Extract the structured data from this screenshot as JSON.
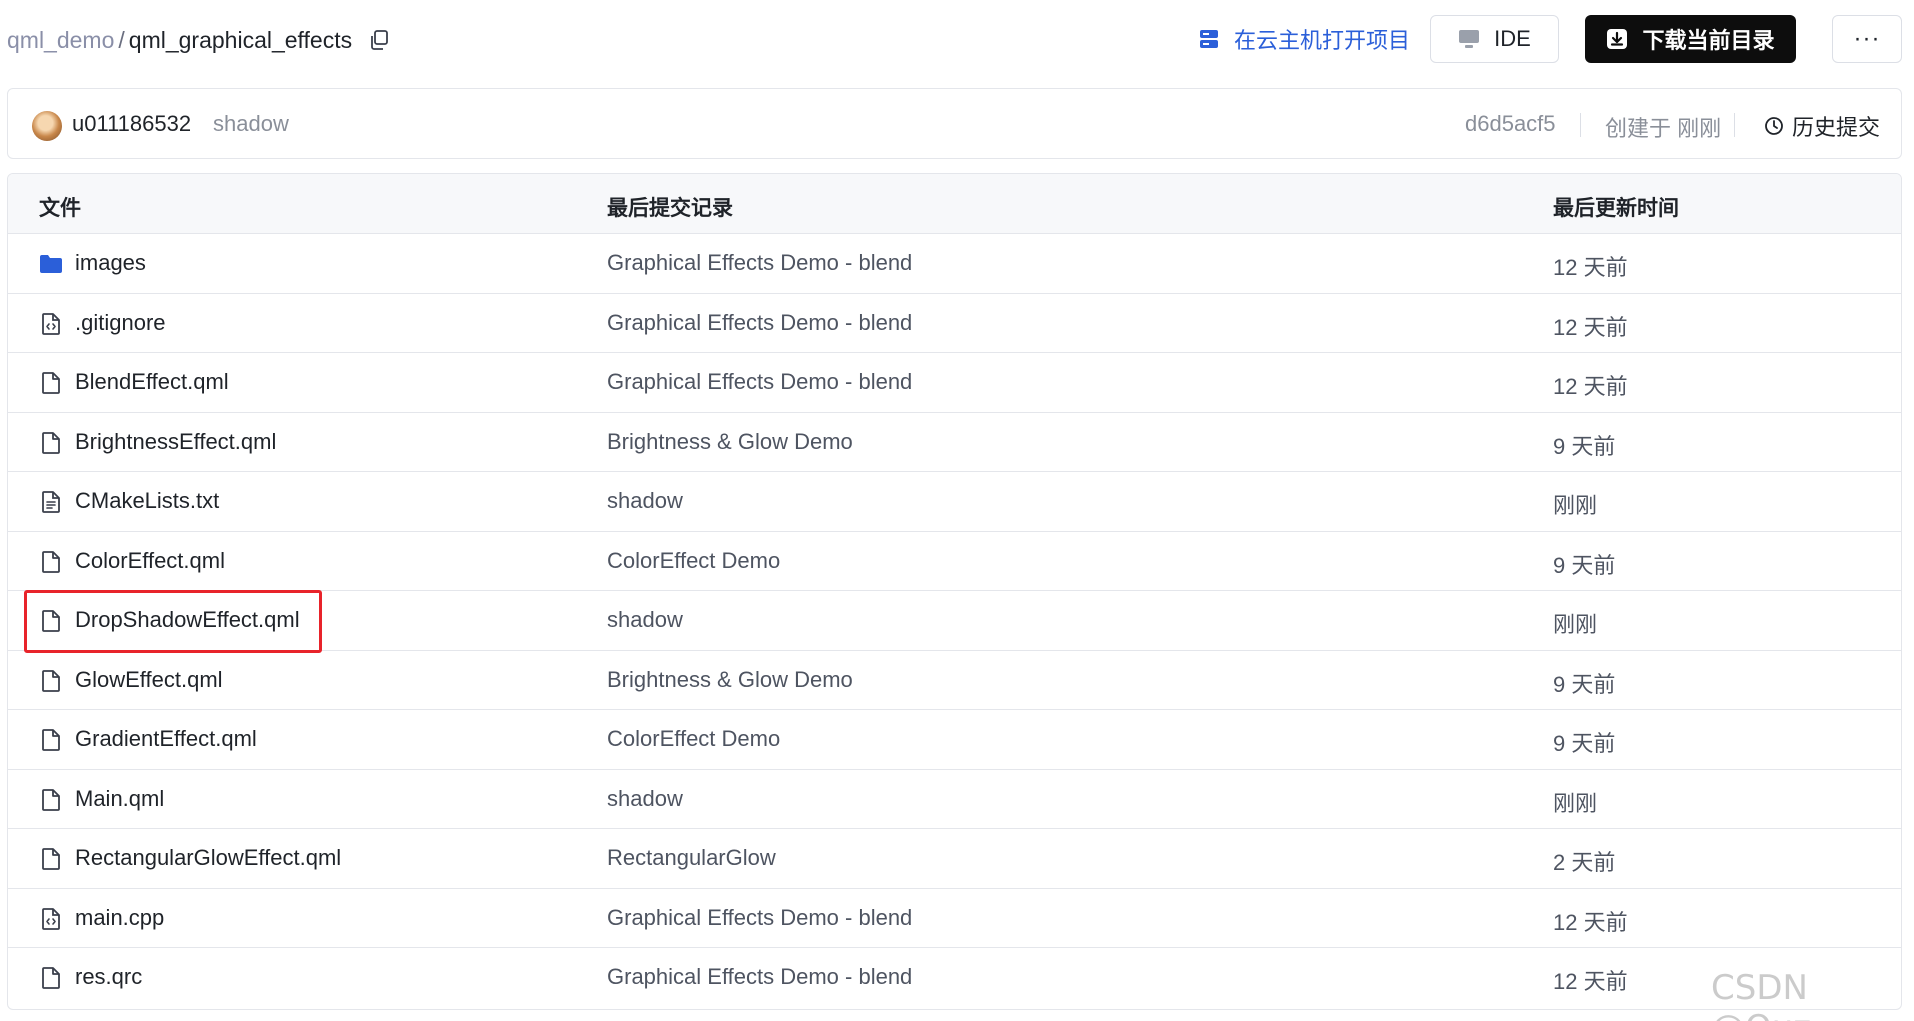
{
  "breadcrumb": {
    "parent": "qml_demo",
    "separator": "/",
    "current": "qml_graphical_effects"
  },
  "actions": {
    "cloud_label": "在云主机打开项目",
    "ide_label": "IDE",
    "download_label": "下载当前目录",
    "more_label": "···"
  },
  "commit": {
    "user": "u011186532",
    "message": "shadow",
    "hash": "d6d5acf5",
    "created": "创建于 刚刚",
    "history_label": "历史提交"
  },
  "table": {
    "headers": {
      "file": "文件",
      "commit": "最后提交记录",
      "time": "最后更新时间"
    },
    "rows": [
      {
        "icon": "folder",
        "name": "images",
        "commit": "Graphical Effects Demo - blend",
        "time": "12 天前"
      },
      {
        "icon": "code-file",
        "name": ".gitignore",
        "commit": "Graphical Effects Demo - blend",
        "time": "12 天前"
      },
      {
        "icon": "file",
        "name": "BlendEffect.qml",
        "commit": "Graphical Effects Demo - blend",
        "time": "12 天前"
      },
      {
        "icon": "file",
        "name": "BrightnessEffect.qml",
        "commit": "Brightness & Glow Demo",
        "time": "9 天前"
      },
      {
        "icon": "text-file",
        "name": "CMakeLists.txt",
        "commit": "shadow",
        "time": "刚刚"
      },
      {
        "icon": "file",
        "name": "ColorEffect.qml",
        "commit": "ColorEffect Demo",
        "time": "9 天前"
      },
      {
        "icon": "file",
        "name": "DropShadowEffect.qml",
        "commit": "shadow",
        "time": "刚刚"
      },
      {
        "icon": "file",
        "name": "GlowEffect.qml",
        "commit": "Brightness & Glow Demo",
        "time": "9 天前"
      },
      {
        "icon": "file",
        "name": "GradientEffect.qml",
        "commit": "ColorEffect Demo",
        "time": "9 天前"
      },
      {
        "icon": "file",
        "name": "Main.qml",
        "commit": "shadow",
        "time": "刚刚"
      },
      {
        "icon": "file",
        "name": "RectangularGlowEffect.qml",
        "commit": "RectangularGlow",
        "time": "2 天前"
      },
      {
        "icon": "code-file",
        "name": "main.cpp",
        "commit": "Graphical Effects Demo - blend",
        "time": "12 天前"
      },
      {
        "icon": "file",
        "name": "res.qrc",
        "commit": "Graphical Effects Demo - blend",
        "time": "12 天前"
      }
    ]
  },
  "watermark": "CSDN @Quz",
  "colors": {
    "accent_blue": "#2b5fd9",
    "folder_blue": "#2b5fd9",
    "highlight_red": "#e8232a",
    "download_bg": "#0d0d0d"
  }
}
